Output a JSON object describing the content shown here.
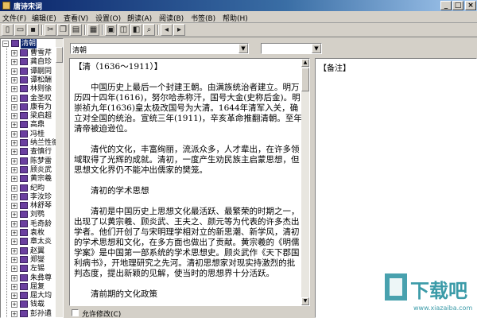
{
  "window": {
    "title": "唐诗宋词",
    "min": "_",
    "max": "□",
    "close": "×"
  },
  "menu": [
    "文件(F)",
    "编辑(E)",
    "查看(V)",
    "设置(O)",
    "朗读(A)",
    "阅读(B)",
    "书签(B)",
    "帮助(H)"
  ],
  "toolbar": {
    "icons": [
      "new-file-icon",
      "open-icon",
      "save-icon",
      "cut-icon",
      "copy-icon",
      "paste-icon",
      "book-icon",
      "pages-icon",
      "prev-page-icon",
      "next-page-icon",
      "find-icon",
      "arrow-left-icon",
      "arrow-right-icon"
    ]
  },
  "tree": {
    "root": "清朝",
    "items": [
      "曹雪芹",
      "龚自珍",
      "谭嗣同",
      "谭松酬",
      "林则徐",
      "金圣叹",
      "康有为",
      "梁启超",
      "高鼎",
      "冯桂",
      "纳兰性德",
      "查慎行",
      "陈梦雷",
      "顾炎武",
      "黄宗羲",
      "纪昀",
      "李汝珍",
      "林舒琴",
      "刘鹗",
      "毛奇龄",
      "袁枚",
      "章太炎",
      "赵翼",
      "郑燮",
      "左锡",
      "朱彝尊",
      "屈复",
      "屈大均",
      "钱载",
      "彭孙遹"
    ]
  },
  "select1": {
    "value": "清朝"
  },
  "select2": {
    "value": ""
  },
  "text": {
    "heading": "【清（1636～1911）】",
    "paragraphs": [
      "中国历史上最后一个封建王朝。由满族统治者建立。明万历四十四年(1616)，努尔哈赤称汗，国号大金(史称后金)。明崇祯九年(1636)皇太极改国号为大清。1644年清军入关，确立对全国的统治。宣统三年(1911)，辛亥革命推翻清朝。至年清帝被迫逊位。",
      "清代的文化，丰富绚丽，流派众多，人才辈出，在许多领域取得了光辉的成就。清初，一度产生劝民族主启蒙思想，但思想文化界仍不能冲出儒家的樊笼。",
      "清初的学术思想",
      "清初是中国历史上思想文化最活跃、最繁荣的时期之一，出现了以黄宗羲、顾炎武、王夫之、颜元等为代表的许多杰出学者。他们开创了与宋明理学相对立的新思潮、新学风，清初的学术思想和文化，在多方面也做出了贡献。黄宗羲的《明儒学案》是中国第一部系统的学术思想史。顾炎武作《天下郡国利病书》，开地理研究之先河。清初思想家对现实持激烈的批判态度，提出新颖的见解，使当时的思想界十分活跃。",
      "清前期的文化政策"
    ]
  },
  "notes": {
    "header": "【备注】"
  },
  "checkbox": {
    "label": "允许修改(C)",
    "checked": false
  },
  "watermark": {
    "text": "下载吧",
    "url_text": "www.xiazaiba.com"
  },
  "colors": {
    "titlebar": "#0a246a",
    "selection": "#0a246a",
    "book": "#6b3fa0",
    "watermark": "#1a8a9a"
  }
}
